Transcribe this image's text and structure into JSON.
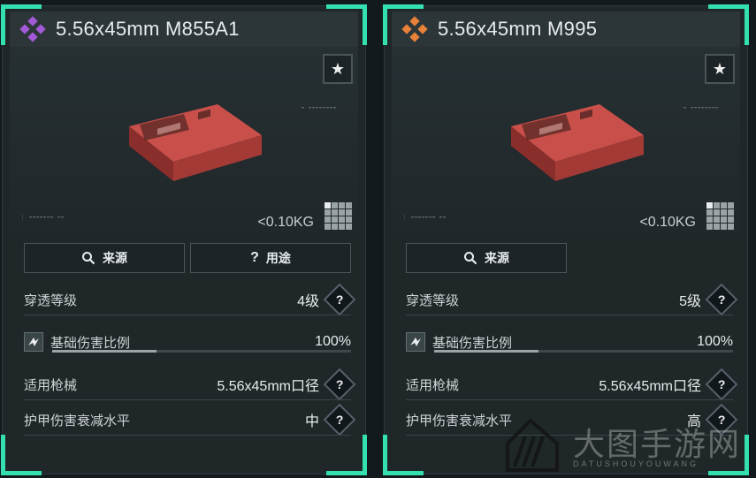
{
  "cards": [
    {
      "title": "5.56x45mm M855A1",
      "rarity_color": "#a35ad8",
      "rarity_icon": "diamond-cluster-icon",
      "weight": "<0.10KG",
      "buttons": [
        {
          "label": "来源",
          "icon": "search-icon"
        },
        {
          "label": "用途",
          "icon": "question-icon"
        }
      ],
      "stats": {
        "penetration": {
          "label": "穿透等级",
          "value": "4级"
        },
        "damage_ratio": {
          "label": "基础伤害比例",
          "value": "100%",
          "fill": 0.35
        },
        "weapon": {
          "label": "适用枪械",
          "value": "5.56x45mm口径"
        },
        "armor_decay": {
          "label": "护甲伤害衰减水平",
          "value": "中"
        }
      }
    },
    {
      "title": "5.56x45mm M995",
      "rarity_color": "#e8823a",
      "rarity_icon": "diamond-cluster-icon",
      "weight": "<0.10KG",
      "buttons": [
        {
          "label": "来源",
          "icon": "search-icon"
        }
      ],
      "stats": {
        "penetration": {
          "label": "穿透等级",
          "value": "5级"
        },
        "damage_ratio": {
          "label": "基础伤害比例",
          "value": "100%",
          "fill": 0.35
        },
        "weapon": {
          "label": "适用枪械",
          "value": "5.56x45mm口径"
        },
        "armor_decay": {
          "label": "护甲伤害衰减水平",
          "value": "高"
        }
      }
    }
  ],
  "help_symbol": "?",
  "star_symbol": "★",
  "watermark": {
    "cn": "大图手游网",
    "en": "DATUSHOUYOUWANG"
  }
}
